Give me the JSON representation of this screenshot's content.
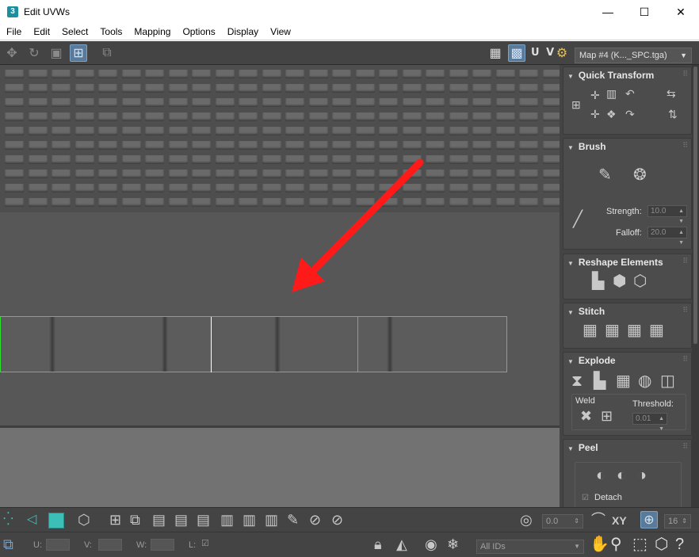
{
  "window": {
    "title": "Edit UVWs",
    "app_icon_text": "3",
    "minimize_symbol": "—",
    "maximize_symbol": "☐",
    "close_symbol": "✕"
  },
  "menu": [
    "File",
    "Edit",
    "Select",
    "Tools",
    "Mapping",
    "Options",
    "Display",
    "View"
  ],
  "toolbar": {
    "uv_label": "U V",
    "map_select": "Map #4 (K..._SPC.tga)"
  },
  "panel": {
    "quick_transform": {
      "title": "Quick Transform"
    },
    "brush": {
      "title": "Brush",
      "strength_label": "Strength:",
      "strength_value": "10.0",
      "falloff_label": "Falloff:",
      "falloff_value": "20.0"
    },
    "reshape": {
      "title": "Reshape Elements"
    },
    "stitch": {
      "title": "Stitch"
    },
    "explode": {
      "title": "Explode",
      "weld_label": "Weld",
      "threshold_label": "Threshold:",
      "threshold_value": "0.01"
    },
    "peel": {
      "title": "Peel",
      "detach_label": "Detach",
      "detach_checked": true
    }
  },
  "bottom": {
    "angle_value": "0.0",
    "xy_label": "XY",
    "snap_value": "16",
    "u_label": "U:",
    "v_label": "V:",
    "w_label": "W:",
    "l_label": "L:",
    "ids_select": "All IDs"
  },
  "colors": {
    "uv_outline": "#2fe02f",
    "arrow": "#ff1a1a",
    "teal_swatch": "#3cbfb7",
    "active_button": "#5a7a9a"
  }
}
